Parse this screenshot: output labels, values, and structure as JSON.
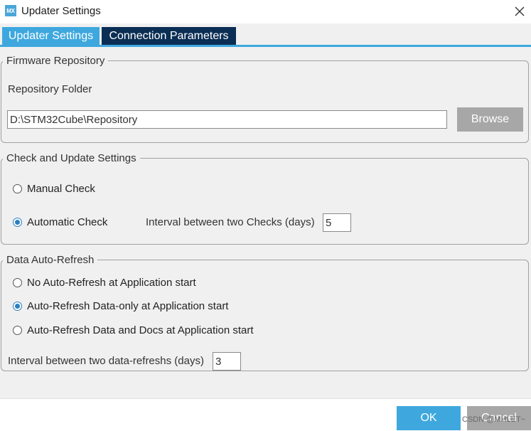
{
  "window": {
    "title": "Updater Settings",
    "logo_text": "MX"
  },
  "tabs": [
    {
      "label": "Updater Settings",
      "active": true
    },
    {
      "label": "Connection Parameters",
      "active": false
    }
  ],
  "firmware_repository": {
    "legend": "Firmware Repository",
    "folder_label": "Repository Folder",
    "folder_value": "D:\\STM32Cube\\Repository",
    "browse_label": "Browse"
  },
  "check_update": {
    "legend": "Check and Update Settings",
    "manual_label": "Manual Check",
    "automatic_label": "Automatic Check",
    "selected": "automatic",
    "interval_label": "Interval between two Checks (days)",
    "interval_value": "5"
  },
  "auto_refresh": {
    "legend": "Data Auto-Refresh",
    "options": [
      {
        "label": "No Auto-Refresh at Application start",
        "checked": false
      },
      {
        "label": "Auto-Refresh Data-only at Application start",
        "checked": true
      },
      {
        "label": "Auto-Refresh Data and Docs at Application start",
        "checked": false
      }
    ],
    "interval_label": "Interval between two data-refreshs (days)",
    "interval_value": "3"
  },
  "footer": {
    "ok_label": "OK",
    "cancel_label": "Cancel",
    "watermark": "CSDN @MHLET~"
  },
  "colors": {
    "accent": "#3ea8de",
    "tab_inactive": "#0b2e54",
    "button_gray": "#a7a7a7",
    "panel_bg": "#f0f0f0"
  }
}
